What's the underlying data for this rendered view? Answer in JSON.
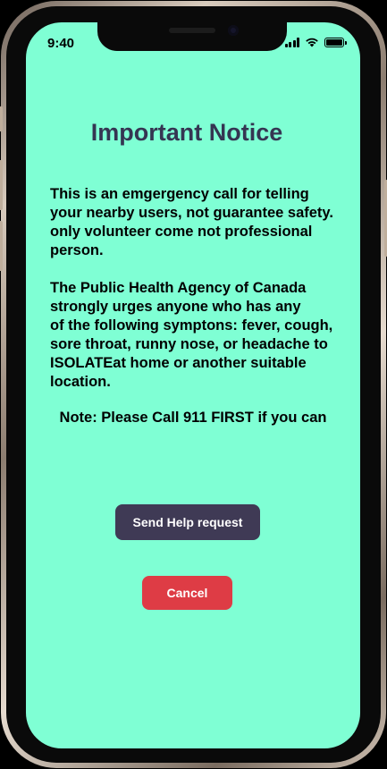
{
  "status_bar": {
    "time": "9:40"
  },
  "notice": {
    "title": "Important Notice",
    "paragraph1": "This is an emgergency call for telling\nyour nearby users, not guarantee safety.\nonly volunteer come not professional\nperson.",
    "paragraph2": "The Public Health Agency of Canada\nstrongly urges anyone who has any\nof the following symptons: fever, cough,\nsore throat, runny nose, or headache to\nISOLATEat home or another suitable\nlocation.",
    "note": "Note: Please Call 911 FIRST if you can"
  },
  "actions": {
    "send_label": "Send Help request",
    "cancel_label": "Cancel"
  },
  "colors": {
    "screen_background": "#7fffd4",
    "title_color": "#353552",
    "send_button": "#3f3a55",
    "cancel_button": "#de3c45"
  },
  "icons": [
    "cellular-signal-icon",
    "wifi-icon",
    "battery-icon"
  ]
}
